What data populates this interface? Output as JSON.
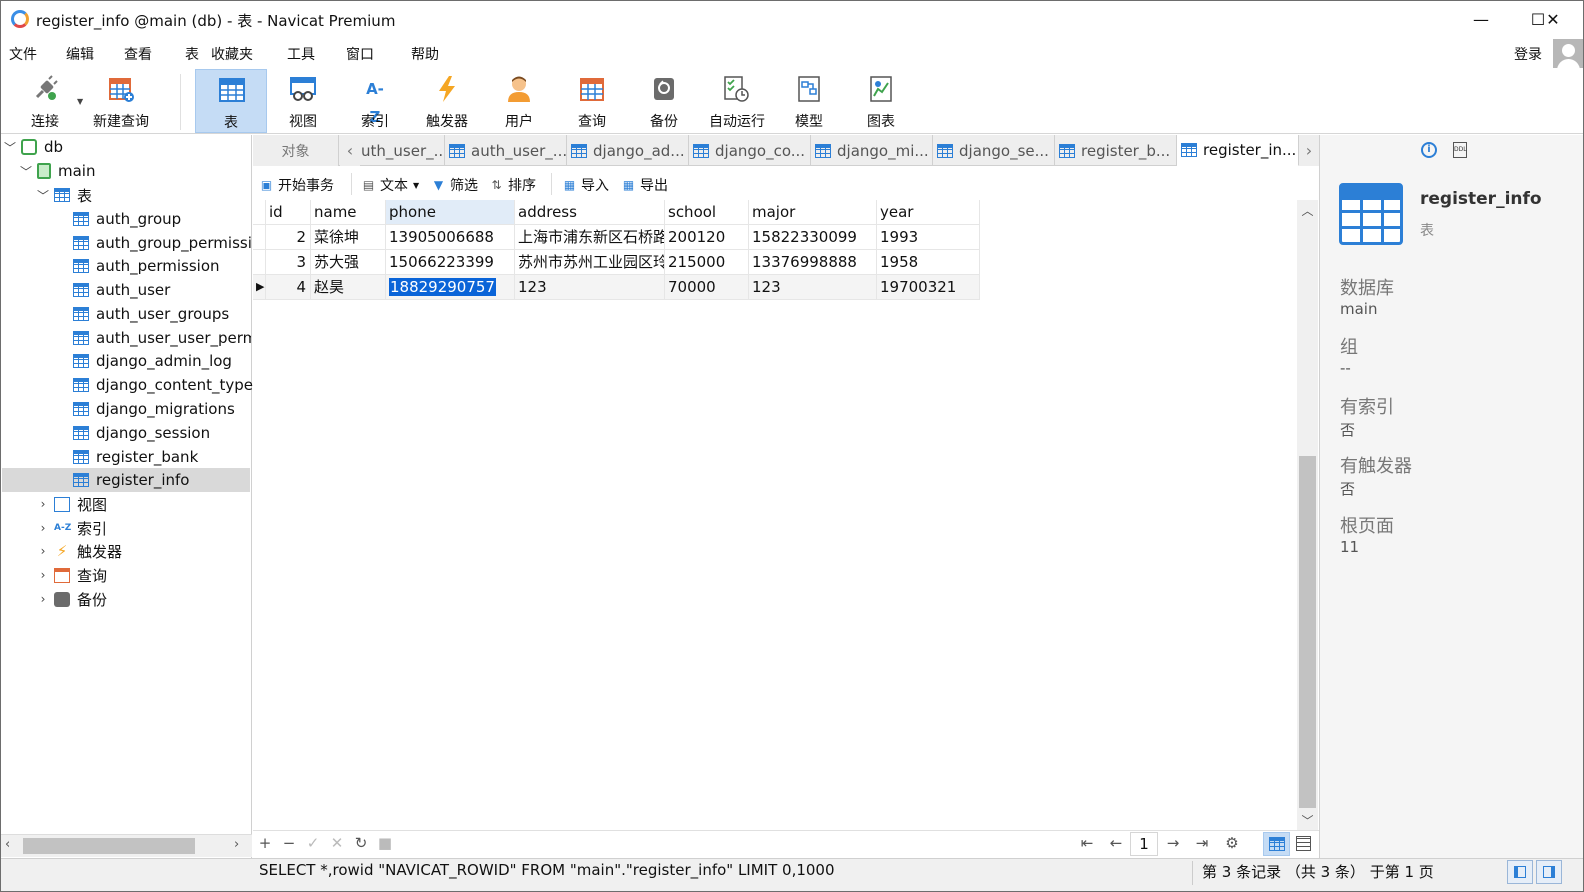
{
  "window": {
    "title": "register_info @main (db) - 表 - Navicat Premium",
    "minimize": "—",
    "maximize": "☐",
    "close": "✕"
  },
  "menu": {
    "items": [
      "文件",
      "编辑",
      "查看",
      "表",
      "收藏夹",
      "工具",
      "窗口",
      "帮助"
    ],
    "login": "登录"
  },
  "toolbar": {
    "connect": "连接",
    "new_query": "新建查询",
    "table": "表",
    "view": "视图",
    "index": "索引",
    "trigger": "触发器",
    "user": "用户",
    "query": "查询",
    "backup": "备份",
    "auto_run": "自动运行",
    "model": "模型",
    "chart": "图表",
    "index_icon_text": "A-Z"
  },
  "tree": {
    "db": "db",
    "main": "main",
    "tables_label": "表",
    "tables": [
      "auth_group",
      "auth_group_permissio",
      "auth_permission",
      "auth_user",
      "auth_user_groups",
      "auth_user_user_permi",
      "django_admin_log",
      "django_content_type",
      "django_migrations",
      "django_session",
      "register_bank",
      "register_info"
    ],
    "views": "视图",
    "indexes": "索引",
    "triggers": "触发器",
    "queries": "查询",
    "backups": "备份",
    "index_icon_text": "A-Z"
  },
  "tabs": {
    "objects": "对象",
    "items": [
      "uth_user_...",
      "auth_user_...",
      "django_ad...",
      "django_co...",
      "django_mi...",
      "django_se...",
      "register_b...",
      "register_in..."
    ]
  },
  "subtoolbar": {
    "begin_tx": "开始事务",
    "text": "文本",
    "filter": "筛选",
    "sort": "排序",
    "import": "导入",
    "export": "导出"
  },
  "grid": {
    "columns": [
      "id",
      "name",
      "phone",
      "address",
      "school",
      "major",
      "year"
    ],
    "rows": [
      [
        "2",
        "菜徐坤",
        "13905006688",
        "上海市浦东新区石桥路",
        "200120",
        "15822330099",
        "1993"
      ],
      [
        "3",
        "苏大强",
        "15066223399",
        "苏州市苏州工业园区玲",
        "215000",
        "13376998888",
        "1958"
      ],
      [
        "4",
        "赵昊",
        "18829290757",
        "123",
        "70000",
        "123",
        "19700321"
      ]
    ]
  },
  "bottom": {
    "add": "+",
    "remove": "−",
    "apply": "✓",
    "cancel": "✕",
    "refresh": "↻",
    "stop": "■",
    "first": "⇤",
    "prev": "←",
    "page": "1",
    "next": "→",
    "last": "⇥",
    "settings": "⚙"
  },
  "status": {
    "sql": "SELECT *,rowid \"NAVICAT_ROWID\" FROM \"main\".\"register_info\" LIMIT 0,1000",
    "records": "第 3 条记录 （共 3 条） 于第 1 页"
  },
  "info": {
    "name": "register_info",
    "type": "表",
    "fields": [
      {
        "label": "数据库",
        "value": "main"
      },
      {
        "label": "组",
        "value": "--"
      },
      {
        "label": "有索引",
        "value": "否"
      },
      {
        "label": "有触发器",
        "value": "否"
      },
      {
        "label": "根页面",
        "value": "11"
      }
    ],
    "ddl_icon_text": "DDL"
  },
  "colors": {
    "accent": "#2c7fd6",
    "selection": "#0a64d8",
    "active_tab_bg": "#c5dcf5"
  }
}
